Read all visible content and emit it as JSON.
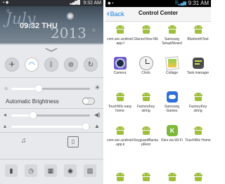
{
  "left": {
    "status": {
      "left_icons": "▪ ◆",
      "signal": "▂▄▆█",
      "time": "9:32 AM"
    },
    "wallpaper": {
      "month": "July",
      "clock": "09:32 THU",
      "year": "2013"
    },
    "toggles": [
      {
        "icon": "airplane-icon",
        "glyph": "✈",
        "on": false
      },
      {
        "icon": "wifi-icon",
        "glyph": "◠",
        "on": true
      },
      {
        "icon": "bluetooth-icon",
        "glyph": "ᛒ",
        "on": false
      },
      {
        "icon": "hotspot-icon",
        "glyph": "⊚",
        "on": false
      },
      {
        "icon": "rotation-lock-icon",
        "glyph": "↻",
        "on": false
      }
    ],
    "auto_brightness_label": "Automatic Brightness",
    "sliders": {
      "brightness": 0.35,
      "media_volume": 0.28,
      "ring_volume": 0.95
    },
    "dock": [
      {
        "icon": "flashlight-icon",
        "glyph": "▮"
      },
      {
        "icon": "timer-icon",
        "glyph": "◷"
      },
      {
        "icon": "calculator-icon",
        "glyph": "▦"
      },
      {
        "icon": "camera-icon",
        "glyph": "◉"
      },
      {
        "icon": "gallery-icon",
        "glyph": "▨"
      }
    ]
  },
  "right": {
    "status": {
      "left_icons": "◆ ▪",
      "icons": "☰ ▂▄▆",
      "time": "9:31 AM"
    },
    "back_label": "Back",
    "title": "Control Center",
    "apps": [
      {
        "label": "com.sec.android.app.f",
        "icon": "android"
      },
      {
        "label": "GlanceView Mk",
        "icon": "android"
      },
      {
        "label": "Samsung SetupWizard",
        "icon": "android"
      },
      {
        "label": "BluetoothTest",
        "icon": "android"
      },
      {
        "label": "Camera",
        "icon": "camera"
      },
      {
        "label": "Clock",
        "icon": "clock"
      },
      {
        "label": "Collage",
        "icon": "collage"
      },
      {
        "label": "Task manager",
        "icon": "task"
      },
      {
        "label": "TouchWiz easy home",
        "icon": "android"
      },
      {
        "label": "FactoryKey string",
        "icon": "android"
      },
      {
        "label": "Samsung Games",
        "icon": "games"
      },
      {
        "label": "FactoryKey string",
        "icon": "android"
      },
      {
        "label": "com.sec.android.app.k",
        "icon": "android"
      },
      {
        "label": "KeyguardBackupRest",
        "icon": "android"
      },
      {
        "label": "Kies via Wi-Fi",
        "icon": "kies"
      },
      {
        "label": "TouchWiz Home",
        "icon": "android"
      }
    ]
  }
}
